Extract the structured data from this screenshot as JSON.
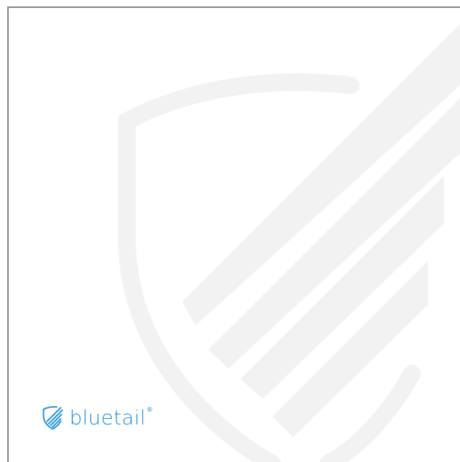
{
  "brand": {
    "wordmark": "bluetail",
    "registered_mark": "®"
  },
  "icons": {
    "logo_mark": "shield-stripes-icon",
    "watermark": "shield-stripes-watermark"
  },
  "colors": {
    "brand_blue": "#1e8fd8",
    "watermark_gray": "#f2f2f2",
    "frame_border": "#8e8e8e",
    "background": "#ffffff"
  }
}
